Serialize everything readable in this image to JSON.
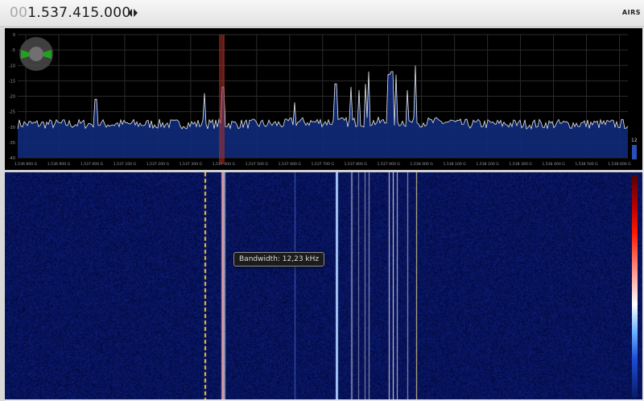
{
  "toolbar": {
    "frequency_prefix": "00",
    "frequency_main": "1.537.415.000",
    "logo_text": "AIRS"
  },
  "spectrum": {
    "y_ticks": [
      "0",
      "-5",
      "-10",
      "-15",
      "-20",
      "-25",
      "-30",
      "-35",
      "-40"
    ],
    "x_ticks": [
      "1,536 800 G",
      "1,536 900 G",
      "1,537 000 G",
      "1,537 100 G",
      "1,537 200 G",
      "1,537 300 G",
      "1,537 400 G",
      "1,537 500 G",
      "1,537 600 G",
      "1,537 700 G",
      "1,537 800 G",
      "1,537 900 G",
      "1,538 000 G",
      "1,538 100 G",
      "1,538 200 G",
      "1,538 300 G",
      "1,538 400 G",
      "1,538 500 G",
      "1,538 600 G"
    ],
    "side_value": "12",
    "colors": {
      "grid": "#2b2b2b",
      "trace": "#e8e8e8",
      "fill": "#0e2a7a",
      "center_marker": "#b0322a",
      "dial_green": "#1fa31f"
    }
  },
  "waterfall": {
    "tooltip": "Bandwidth: 12,23 kHz"
  }
}
